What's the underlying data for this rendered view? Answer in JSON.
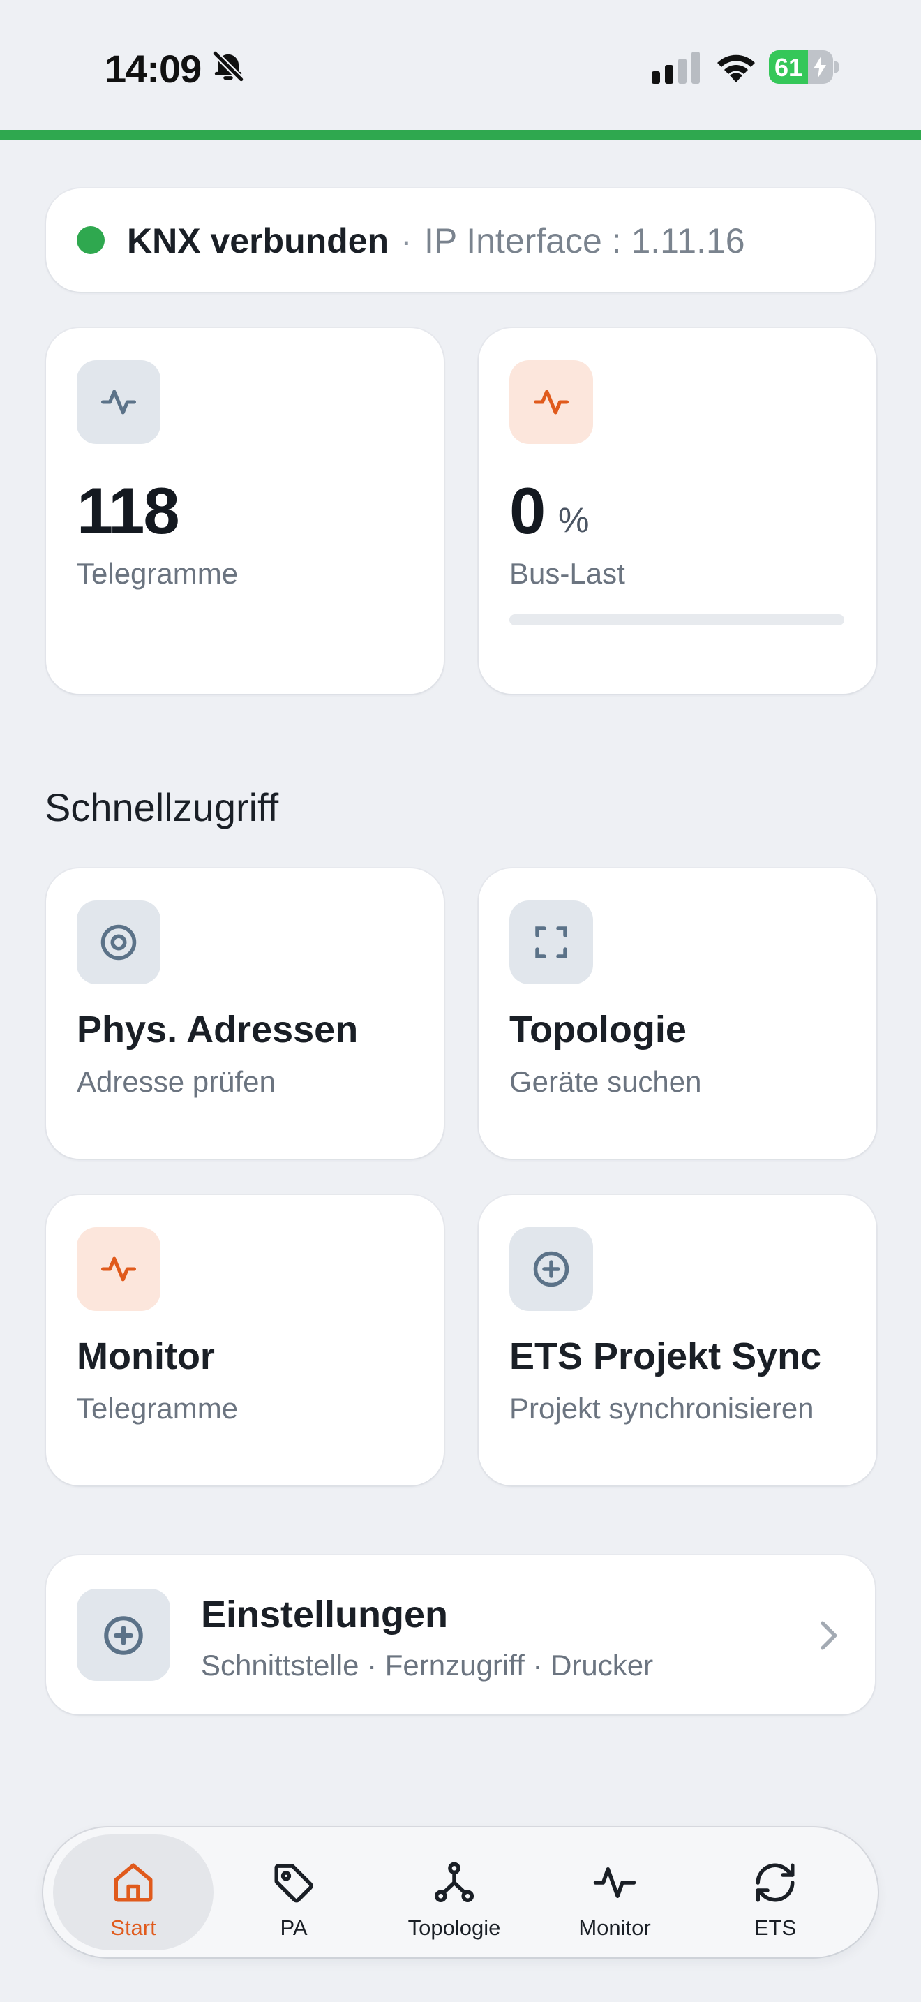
{
  "status_bar": {
    "time": "14:09",
    "battery_level": "61",
    "battery_fraction": 0.61
  },
  "colors": {
    "accent_orange": "#e05a1c",
    "connected_green": "#2fa84f",
    "background": "#eef0f4"
  },
  "connection": {
    "status": "KNX verbunden",
    "separator": "·",
    "interface": "IP Interface : 1.11.16"
  },
  "stats": {
    "telegrams": {
      "value": "118",
      "label": "Telegramme",
      "icon": "activity-icon"
    },
    "bus_load": {
      "value": "0",
      "unit": "%",
      "label": "Bus-Last",
      "icon": "activity-icon",
      "percent": 0
    }
  },
  "quick_access": {
    "title": "Schnellzugriff",
    "tiles": [
      {
        "title": "Phys. Adressen",
        "subtitle": "Adresse prüfen",
        "icon": "target-icon"
      },
      {
        "title": "Topologie",
        "subtitle": "Geräte suchen",
        "icon": "scan-icon"
      },
      {
        "title": "Monitor",
        "subtitle": "Telegramme",
        "icon": "activity-icon"
      },
      {
        "title": "ETS Projekt Sync",
        "subtitle": "Projekt synchronisieren",
        "icon": "plus-circle-icon"
      }
    ]
  },
  "settings": {
    "title": "Einstellungen",
    "subtitle": "Schnittstelle · Fernzugriff · Drucker",
    "icon": "plus-circle-icon"
  },
  "tabbar": {
    "items": [
      {
        "label": "Start",
        "icon": "home-icon",
        "active": true
      },
      {
        "label": "PA",
        "icon": "tag-icon",
        "active": false
      },
      {
        "label": "Topologie",
        "icon": "network-icon",
        "active": false
      },
      {
        "label": "Monitor",
        "icon": "activity-icon",
        "active": false
      },
      {
        "label": "ETS",
        "icon": "refresh-icon",
        "active": false
      }
    ]
  }
}
